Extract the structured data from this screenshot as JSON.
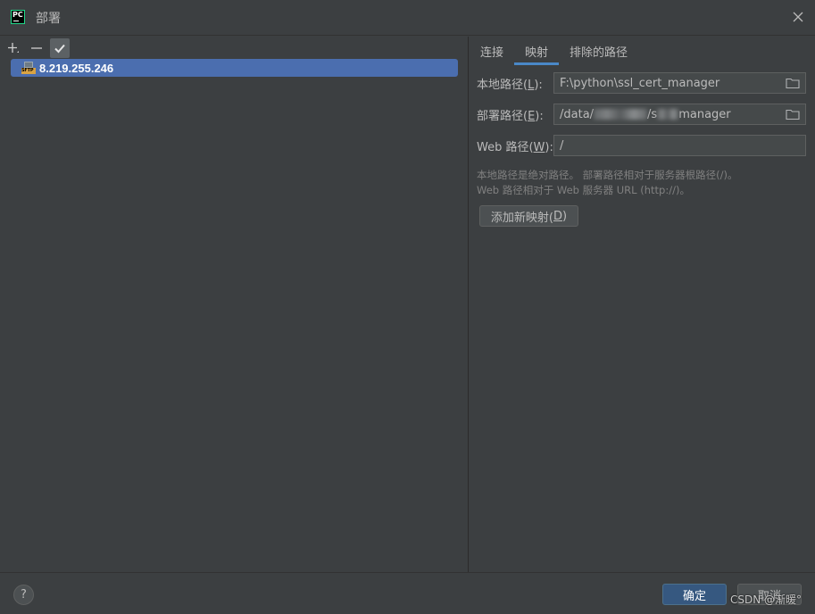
{
  "window": {
    "title": "部署",
    "app_icon_text": "PC"
  },
  "toolbar": {
    "add_icon": "plus-icon",
    "remove_icon": "minus-icon",
    "default_icon": "check-icon"
  },
  "servers": [
    {
      "label": "8.219.255.246",
      "icon": "sftp-icon",
      "icon_text": "SFTP",
      "selected": true
    }
  ],
  "tabs": [
    {
      "label": "连接",
      "selected": false
    },
    {
      "label": "映射",
      "selected": true
    },
    {
      "label": "排除的路径",
      "selected": false
    }
  ],
  "mapping": {
    "local_path": {
      "label_prefix": "本地路径(",
      "mnemonic": "L",
      "label_suffix": "):",
      "value": "F:\\python\\ssl_cert_manager"
    },
    "deploy_path": {
      "label_prefix": "部署路径(",
      "mnemonic": "E",
      "label_suffix": "):",
      "value_start": "/data/",
      "value_mid": "/s",
      "value_end": "manager"
    },
    "web_path": {
      "label_prefix": "Web 路径(",
      "mnemonic": "W",
      "label_suffix": "):",
      "value": "/"
    },
    "hint_line1": "本地路径是绝对路径。 部署路径相对于服务器根路径(/)。",
    "hint_line2": "Web 路径相对于 Web 服务器 URL (http://)。",
    "add_button_prefix": "添加新映射(",
    "add_button_mnemonic": "D",
    "add_button_suffix": ")"
  },
  "footer": {
    "help_label": "?",
    "ok_label": "确定",
    "cancel_label": "取消",
    "watermark": "CSDN @渐暖°"
  },
  "colors": {
    "background": "#3c3f41",
    "selection": "#4b6eaf",
    "tab_underline": "#4a88c7",
    "primary_button": "#365880"
  }
}
